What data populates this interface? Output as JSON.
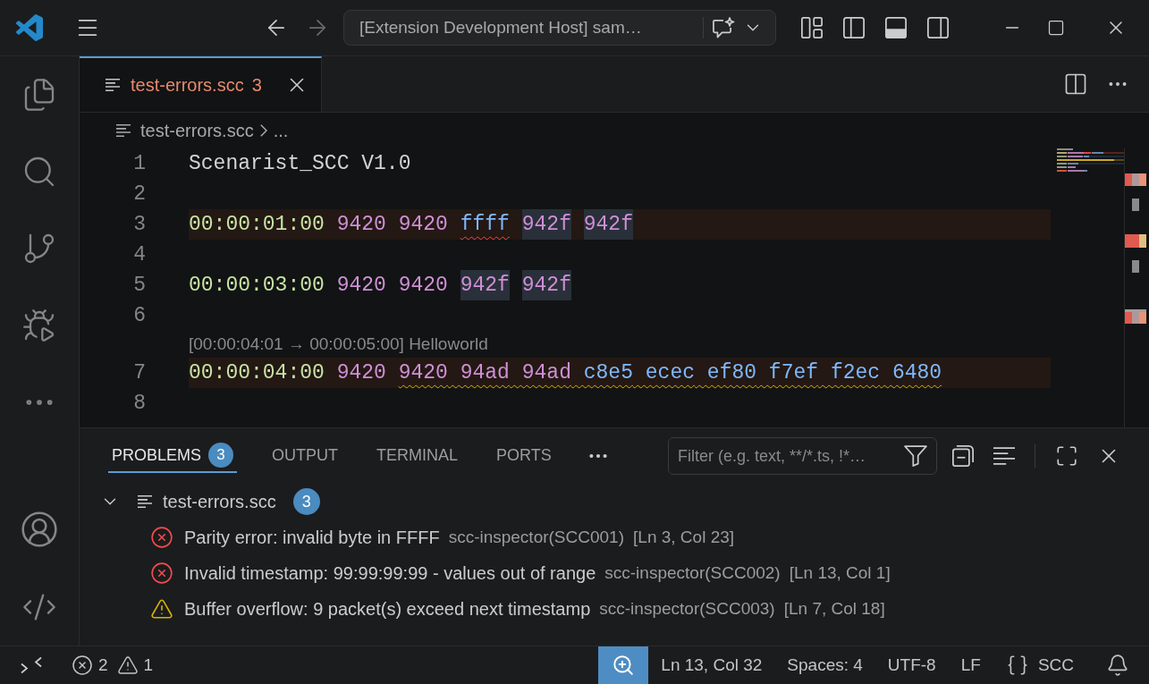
{
  "title_bar": {
    "command_center": "[Extension Development Host] sam…"
  },
  "editor": {
    "tabs": [
      {
        "label": "test-errors.scc",
        "problem_count": "3",
        "selected": true
      }
    ],
    "breadcrumb": [
      "test-errors.scc",
      "..."
    ],
    "lines": [
      {
        "number": "1",
        "line_highlight": false,
        "tokens": [
          {
            "text": "Scenarist_SCC V1.0",
            "kind": "header",
            "highlight": false,
            "error_squiggle": false,
            "warning_squiggle": false
          }
        ]
      },
      {
        "number": "2",
        "line_highlight": false
      },
      {
        "number": "3",
        "line_highlight": true,
        "tokens": [
          {
            "text": "00:00:01:00",
            "kind": "timestamp",
            "highlight": false,
            "error_squiggle": false,
            "warning_squiggle": false
          },
          {
            "text": "9420",
            "kind": "command",
            "highlight": false,
            "error_squiggle": false,
            "warning_squiggle": false
          },
          {
            "text": "9420",
            "kind": "command",
            "highlight": false,
            "error_squiggle": false,
            "warning_squiggle": false
          },
          {
            "text": "ffff",
            "kind": "data",
            "highlight": false,
            "error_squiggle": true,
            "warning_squiggle": false
          },
          {
            "text": "942f",
            "kind": "command",
            "highlight": true,
            "error_squiggle": false,
            "warning_squiggle": false
          },
          {
            "text": "942f",
            "kind": "command",
            "highlight": true,
            "error_squiggle": false,
            "warning_squiggle": false
          }
        ]
      },
      {
        "number": "4",
        "line_highlight": false
      },
      {
        "number": "5",
        "line_highlight": false,
        "tokens": [
          {
            "text": "00:00:03:00",
            "kind": "timestamp",
            "highlight": false,
            "error_squiggle": false,
            "warning_squiggle": false
          },
          {
            "text": "9420",
            "kind": "command",
            "highlight": false,
            "error_squiggle": false,
            "warning_squiggle": false
          },
          {
            "text": "9420",
            "kind": "command",
            "highlight": false,
            "error_squiggle": false,
            "warning_squiggle": false
          },
          {
            "text": "942f",
            "kind": "command",
            "highlight": true,
            "error_squiggle": false,
            "warning_squiggle": false
          },
          {
            "text": "942f",
            "kind": "command",
            "highlight": true,
            "error_squiggle": false,
            "warning_squiggle": false
          }
        ]
      },
      {
        "number": "6",
        "line_highlight": false
      },
      {
        "number": "7",
        "line_highlight": true,
        "annotation": "[00:00:04:01 → 00:00:05:00] Helloworld",
        "tokens": [
          {
            "text": "00:00:04:00",
            "kind": "timestamp",
            "highlight": false,
            "error_squiggle": false,
            "warning_squiggle": false
          },
          {
            "text": "9420",
            "kind": "command",
            "highlight": false,
            "error_squiggle": false,
            "warning_squiggle": false
          },
          {
            "text": "9420",
            "kind": "command",
            "highlight": false,
            "error_squiggle": false,
            "warning_squiggle": true
          },
          {
            "text": "94ad",
            "kind": "command",
            "highlight": false,
            "error_squiggle": false,
            "warning_squiggle": true
          },
          {
            "text": "94ad",
            "kind": "command",
            "highlight": false,
            "error_squiggle": false,
            "warning_squiggle": true
          },
          {
            "text": "c8e5",
            "kind": "data",
            "highlight": false,
            "error_squiggle": false,
            "warning_squiggle": true
          },
          {
            "text": "ecec",
            "kind": "data",
            "highlight": false,
            "error_squiggle": false,
            "warning_squiggle": true
          },
          {
            "text": "ef80",
            "kind": "data",
            "highlight": false,
            "error_squiggle": false,
            "warning_squiggle": true
          },
          {
            "text": "f7ef",
            "kind": "data",
            "highlight": false,
            "error_squiggle": false,
            "warning_squiggle": true
          },
          {
            "text": "f2ec",
            "kind": "data",
            "highlight": false,
            "error_squiggle": false,
            "warning_squiggle": true
          },
          {
            "text": "6480",
            "kind": "data",
            "highlight": false,
            "error_squiggle": false,
            "warning_squiggle": true
          }
        ]
      },
      {
        "number": "8",
        "line_highlight": false
      }
    ]
  },
  "panel": {
    "tabs": [
      {
        "label": "PROBLEMS",
        "badge": "3",
        "selected": true
      },
      {
        "label": "OUTPUT",
        "selected": false
      },
      {
        "label": "TERMINAL",
        "selected": false
      },
      {
        "label": "PORTS",
        "selected": false
      }
    ],
    "filter": {
      "placeholder": "Filter (e.g. text, **/*.ts, !*…"
    },
    "problems": [
      {
        "file": "test-errors.scc",
        "count": "3",
        "expanded": true,
        "items": [
          {
            "kind": "error",
            "message": "Parity error: invalid byte in FFFF",
            "source": "scc-inspector(SCC001)",
            "location": "[Ln 3, Col 23]"
          },
          {
            "kind": "error",
            "message": "Invalid timestamp: 99:99:99:99 - values out of range",
            "source": "scc-inspector(SCC002)",
            "location": "[Ln 13, Col 1]"
          },
          {
            "kind": "warning",
            "message": "Buffer overflow: 9 packet(s) exceed next timestamp",
            "source": "scc-inspector(SCC003)",
            "location": "[Ln 7, Col 18]"
          }
        ]
      }
    ]
  },
  "status_bar": {
    "errors": "2",
    "warnings": "1",
    "items": [
      "Ln 13, Col 32",
      "Spaces: 4",
      "UTF-8",
      "LF"
    ],
    "language": "SCC"
  }
}
